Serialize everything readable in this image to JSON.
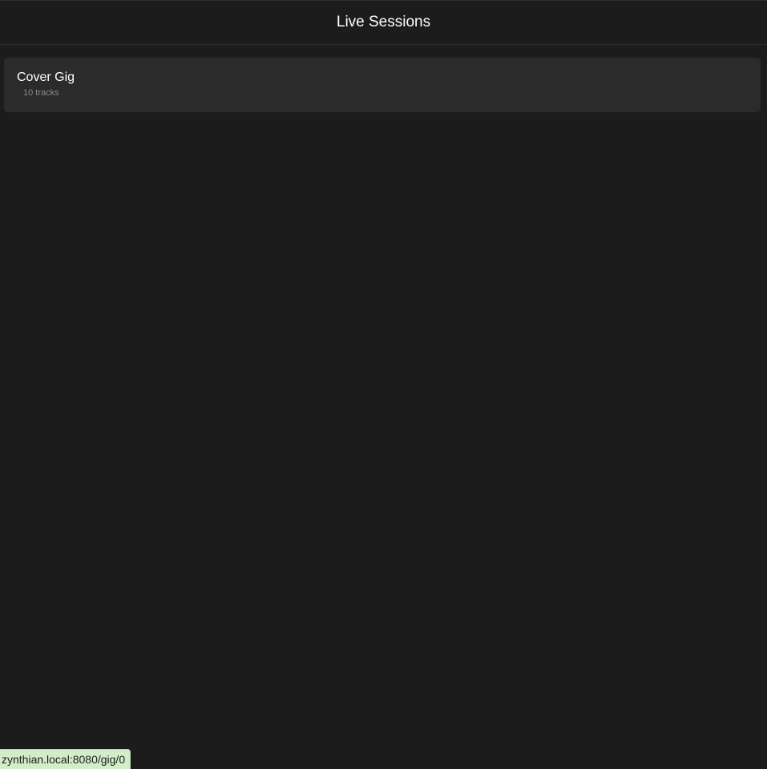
{
  "header": {
    "title": "Live Sessions"
  },
  "sessions": [
    {
      "name": "Cover Gig",
      "meta": "10 tracks"
    }
  ],
  "status_bar": {
    "url": "zynthian.local:8080/gig/0"
  },
  "colors": {
    "background": "#1c1c1c",
    "card": "#2b2b2b",
    "status_bar_bg": "#d3edc8"
  }
}
